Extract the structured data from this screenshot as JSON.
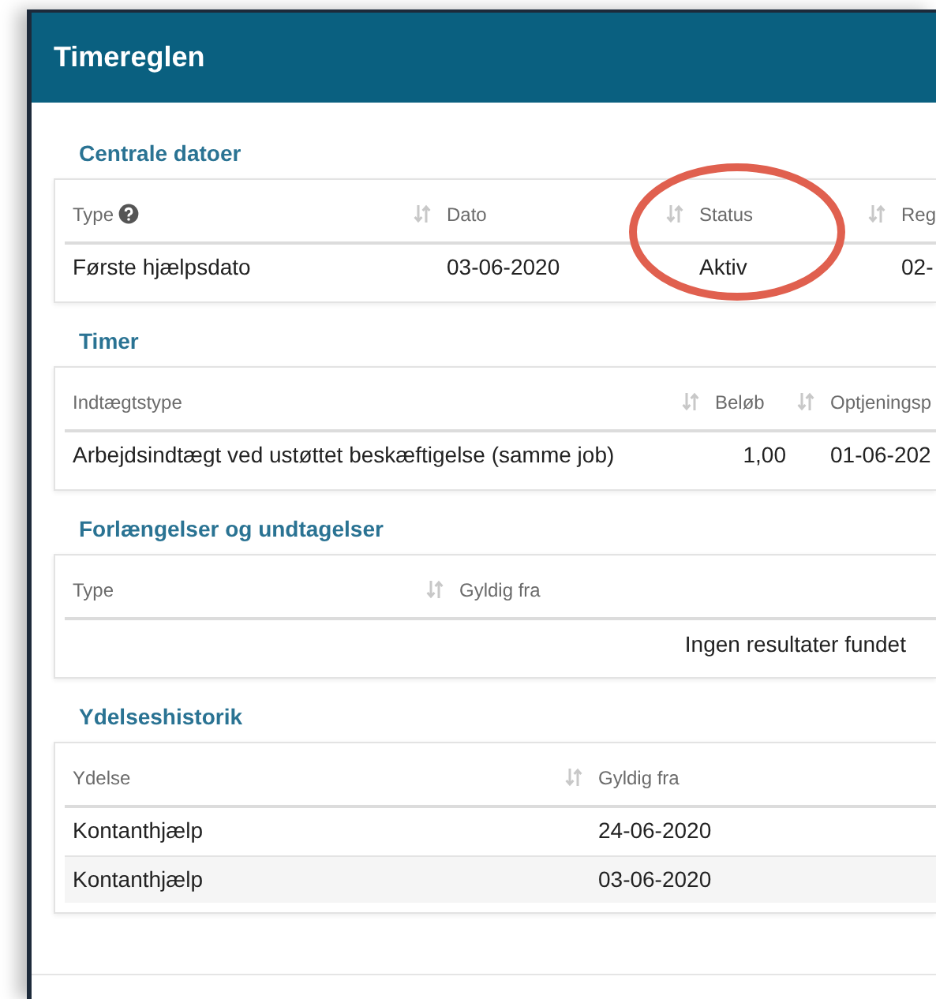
{
  "dialog": {
    "title": "Timereglen"
  },
  "sections": [
    {
      "title": "Centrale datoer",
      "columns": [
        {
          "label": "Type",
          "help": true,
          "sortable": true
        },
        {
          "label": "Dato",
          "help": false,
          "sortable": true
        },
        {
          "label": "Status",
          "help": false,
          "sortable": true
        },
        {
          "label": "Reg",
          "help": false,
          "sortable": false
        }
      ],
      "rows": [
        {
          "cells": [
            "Første hjælpsdato",
            "03-06-2020",
            "Aktiv",
            "02-"
          ]
        }
      ]
    },
    {
      "title": "Timer",
      "columns": [
        {
          "label": "Indtægtstype",
          "help": false,
          "sortable": true
        },
        {
          "label": "Beløb",
          "help": false,
          "sortable": true
        },
        {
          "label": "Optjeningsp",
          "help": false,
          "sortable": false
        }
      ],
      "rows": [
        {
          "cells": [
            "Arbejdsindtægt ved ustøttet beskæftigelse (samme job)",
            "1,00",
            "01-06-202"
          ]
        }
      ]
    },
    {
      "title": "Forlængelser og undtagelser",
      "columns": [
        {
          "label": "Type",
          "help": false,
          "sortable": true
        },
        {
          "label": "Gyldig fra",
          "help": false,
          "sortable": false
        }
      ],
      "empty_message": "Ingen resultater fundet"
    },
    {
      "title": "Ydelseshistorik",
      "columns": [
        {
          "label": "Ydelse",
          "help": false,
          "sortable": true
        },
        {
          "label": "Gyldig fra",
          "help": false,
          "sortable": false
        }
      ],
      "rows": [
        {
          "cells": [
            "Kontanthjælp",
            "24-06-2020"
          ]
        },
        {
          "cells": [
            "Kontanthjælp",
            "03-06-2020"
          ]
        }
      ]
    }
  ]
}
